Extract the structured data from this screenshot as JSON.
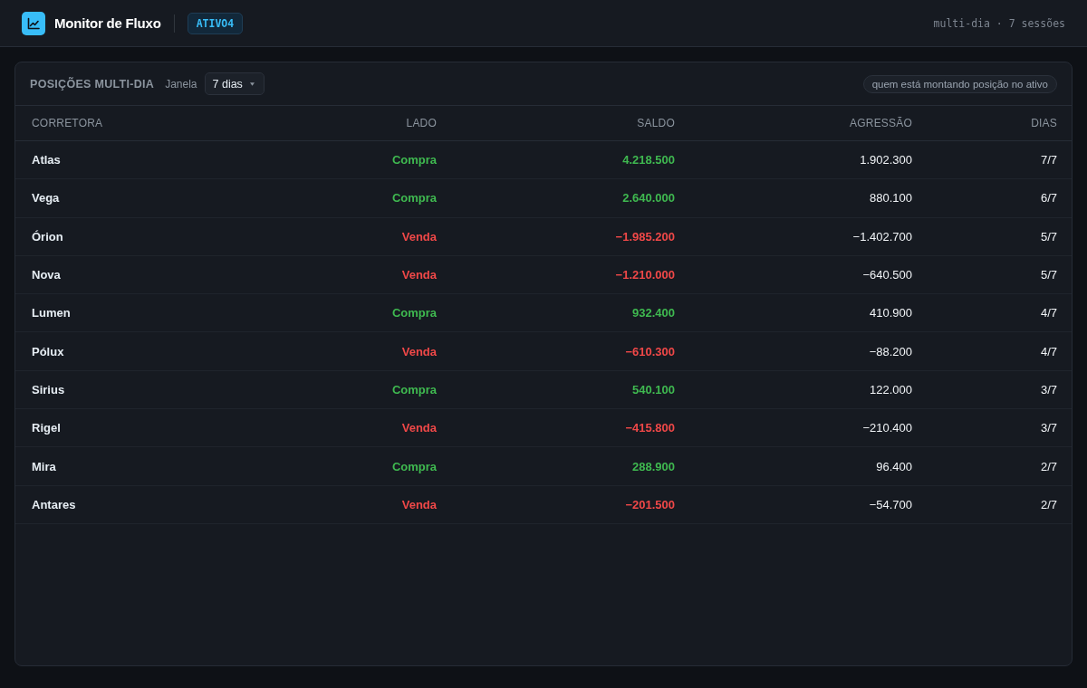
{
  "header": {
    "app_title": "Monitor de Fluxo",
    "asset_badge": "ATIVO4",
    "meta": "multi-dia · 7 sessões"
  },
  "panel": {
    "title": "POSIÇÕES MULTI-DIA",
    "window_label": "Janela",
    "window_select": {
      "value": "7 dias"
    },
    "note": "quem está montando posição no ativo",
    "table": {
      "columns": [
        "CORRETORA",
        "LADO",
        "SALDO",
        "AGRESSÃO",
        "DIAS"
      ],
      "rows": [
        {
          "kind": "buy",
          "corretora": "Atlas",
          "lado": "Compra",
          "saldo": "4.218.500",
          "agressao": "1.902.300",
          "dias": "7/7"
        },
        {
          "kind": "buy",
          "corretora": "Vega",
          "lado": "Compra",
          "saldo": "2.640.000",
          "agressao": "880.100",
          "dias": "6/7"
        },
        {
          "kind": "sell",
          "corretora": "Órion",
          "lado": "Venda",
          "saldo": "−1.985.200",
          "agressao": "−1.402.700",
          "dias": "5/7"
        },
        {
          "kind": "sell",
          "corretora": "Nova",
          "lado": "Venda",
          "saldo": "−1.210.000",
          "agressao": "−640.500",
          "dias": "5/7"
        },
        {
          "kind": "buy",
          "corretora": "Lumen",
          "lado": "Compra",
          "saldo": "932.400",
          "agressao": "410.900",
          "dias": "4/7"
        },
        {
          "kind": "sell",
          "corretora": "Pólux",
          "lado": "Venda",
          "saldo": "−610.300",
          "agressao": "−88.200",
          "dias": "4/7"
        },
        {
          "kind": "buy",
          "corretora": "Sirius",
          "lado": "Compra",
          "saldo": "540.100",
          "agressao": "122.000",
          "dias": "3/7"
        },
        {
          "kind": "sell",
          "corretora": "Rigel",
          "lado": "Venda",
          "saldo": "−415.800",
          "agressao": "−210.400",
          "dias": "3/7"
        },
        {
          "kind": "buy",
          "corretora": "Mira",
          "lado": "Compra",
          "saldo": "288.900",
          "agressao": "96.400",
          "dias": "2/7"
        },
        {
          "kind": "sell",
          "corretora": "Antares",
          "lado": "Venda",
          "saldo": "−201.500",
          "agressao": "−54.700",
          "dias": "2/7"
        }
      ]
    }
  }
}
